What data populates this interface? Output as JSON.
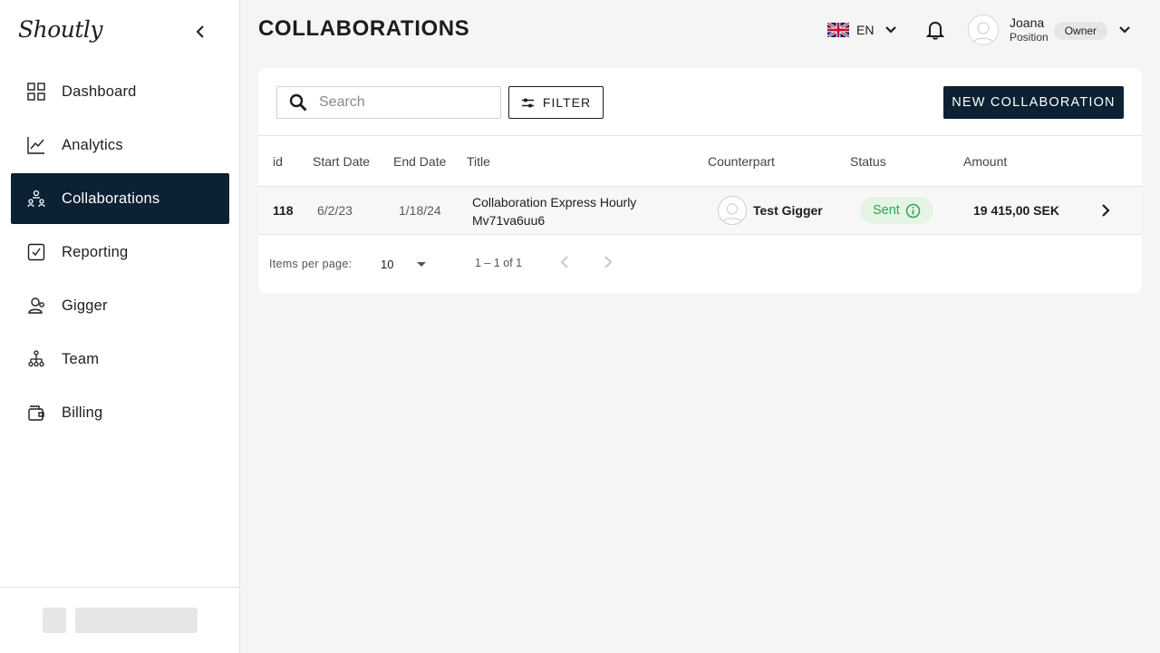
{
  "app": {
    "logo": "Shoutly"
  },
  "sidebar": {
    "items": [
      {
        "label": "Dashboard",
        "icon": "grid-icon",
        "active": false
      },
      {
        "label": "Analytics",
        "icon": "line-chart-icon",
        "active": false
      },
      {
        "label": "Collaborations",
        "icon": "collaborations-icon",
        "active": true
      },
      {
        "label": "Reporting",
        "icon": "checkbox-icon",
        "active": false
      },
      {
        "label": "Gigger",
        "icon": "user-icon",
        "active": false
      },
      {
        "label": "Team",
        "icon": "team-icon",
        "active": false
      },
      {
        "label": "Billing",
        "icon": "wallet-icon",
        "active": false
      }
    ]
  },
  "header": {
    "title": "COLLABORATIONS",
    "language": {
      "code": "EN",
      "flag": "uk-flag-icon"
    },
    "user": {
      "name": "Joana",
      "position": "Position",
      "role": "Owner"
    }
  },
  "toolbar": {
    "search_placeholder": "Search",
    "filter_label": "FILTER",
    "new_label": "NEW COLLABORATION"
  },
  "table": {
    "columns": [
      "id",
      "Start Date",
      "End Date",
      "Title",
      "Counterpart",
      "Status",
      "Amount"
    ],
    "rows": [
      {
        "id": "118",
        "start": "6/2/23",
        "end": "1/18/24",
        "title": "Collaboration Express Hourly Mv71va6uu6",
        "counterpart": "Test Gigger",
        "status": "Sent",
        "amount": "19 415,00 SEK"
      }
    ]
  },
  "pagination": {
    "items_per_page_label": "Items per page:",
    "items_per_page": "10",
    "range": "1 – 1 of 1"
  },
  "colors": {
    "navy": "#0c2133",
    "status_green": "#2ea44f",
    "status_bg": "#e6f4e6"
  }
}
